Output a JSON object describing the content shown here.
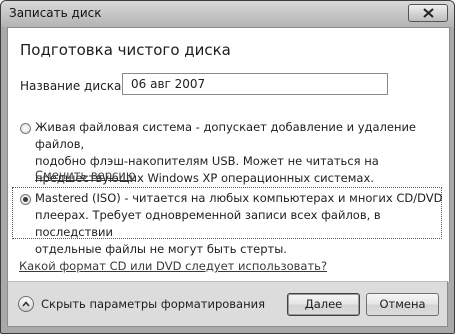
{
  "window": {
    "title": "Записать диск"
  },
  "heading": "Подготовка чистого диска",
  "disk_name": {
    "label": "Название диска:",
    "value": "06 авг 2007"
  },
  "options": [
    {
      "lines": [
        "Живая файловая система - допускает добавление и удаление файлов,",
        "подобно флэш-накопителям USB. Может не читаться на",
        "предшествующих Windows XP операционных системах."
      ],
      "link": "Сменить версию",
      "checked": false
    },
    {
      "lines": [
        "Mastered (ISO) - читается на любых компьютерах и многих CD/DVD",
        "плеерах. Требует одновременной записи всех файлов, в последствии",
        "отдельные файлы не могут быть стерты."
      ],
      "checked": true
    }
  ],
  "help_link": "Какой формат CD или DVD следует использовать?",
  "footer": {
    "hide_options": "Скрыть параметры форматирования",
    "next_button": "Далее",
    "cancel_button": "Отмена"
  },
  "icons": {
    "close": "close-icon",
    "collapse": "chevron-up-icon"
  }
}
